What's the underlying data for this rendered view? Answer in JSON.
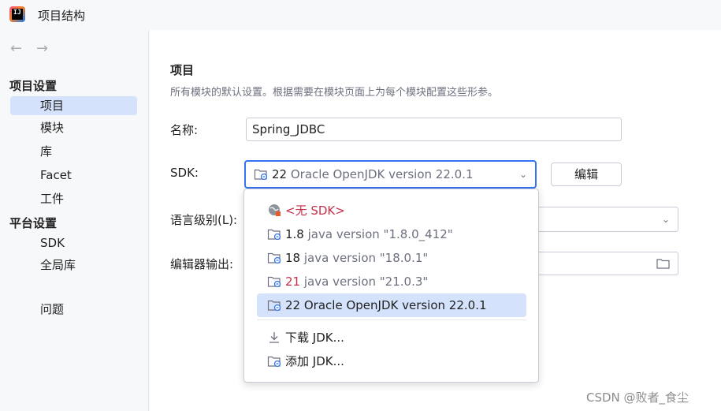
{
  "window": {
    "title": "项目结构",
    "app_icon": "intellij-idea-icon"
  },
  "nav": {
    "back_icon": "arrow-left-icon",
    "forward_icon": "arrow-right-icon"
  },
  "sidebar": {
    "project_settings_header": "项目设置",
    "project_settings_items": [
      "项目",
      "模块",
      "库",
      "Facet",
      "工件"
    ],
    "platform_settings_header": "平台设置",
    "platform_settings_items": [
      "SDK",
      "全局库"
    ],
    "problems_label": "问题",
    "selected_item": "项目"
  },
  "main": {
    "title": "项目",
    "description": "所有模块的默认设置。根据需要在模块页面上为每个模块配置这些形参。",
    "name_label": "名称:",
    "name_value": "Spring_JDBC",
    "sdk_label": "SDK:",
    "sdk_selected_version": "22",
    "sdk_selected_name": "Oracle OpenJDK version 22.0.1",
    "edit_button": "编辑",
    "language_level_label": "语言级别(L):",
    "compiler_output_label": "编辑器输出:"
  },
  "sdk_dropdown": {
    "no_sdk": "<无 SDK>",
    "items": [
      {
        "version": "1.8",
        "name": "java version \"1.8.0_412\"",
        "invalid": false,
        "selected": false
      },
      {
        "version": "18",
        "name": "java version \"18.0.1\"",
        "invalid": false,
        "selected": false
      },
      {
        "version": "21",
        "name": "java version \"21.0.3\"",
        "invalid": true,
        "selected": false
      },
      {
        "version": "22",
        "name": "Oracle OpenJDK version 22.0.1",
        "invalid": false,
        "selected": true
      }
    ],
    "download_jdk": "下载 JDK...",
    "add_jdk": "添加 JDK..."
  },
  "watermark": "CSDN @败者_食尘",
  "colors": {
    "accent": "#3574f0",
    "selection": "#d4e2fb",
    "error": "#c4314b",
    "muted": "#6c707e"
  }
}
